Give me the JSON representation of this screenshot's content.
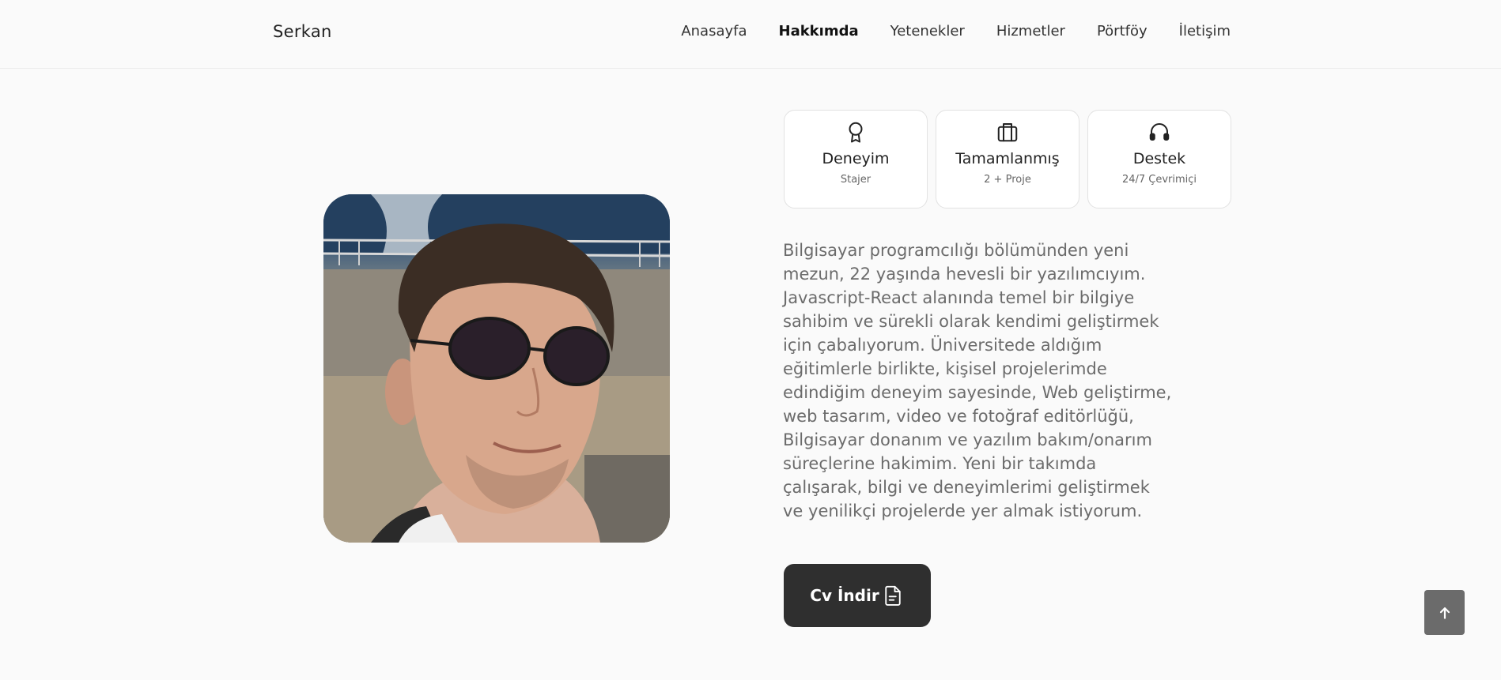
{
  "header": {
    "logo": "Serkan",
    "nav": [
      {
        "label": "Anasayfa",
        "active": false
      },
      {
        "label": "Hakkımda",
        "active": true
      },
      {
        "label": "Yetenekler",
        "active": false
      },
      {
        "label": "Hizmetler",
        "active": false
      },
      {
        "label": "Pörtföy",
        "active": false
      },
      {
        "label": "İletişim",
        "active": false
      }
    ]
  },
  "cards": [
    {
      "icon": "award-icon",
      "title": "Deneyim",
      "subtitle": "Stajer"
    },
    {
      "icon": "briefcase-icon",
      "title": "Tamamlanmış",
      "subtitle": "2 + Proje"
    },
    {
      "icon": "headphones-icon",
      "title": "Destek",
      "subtitle": "24/7 Çevrimiçi"
    }
  ],
  "about": {
    "text": "Bilgisayar programcılığı bölümünden yeni mezun, 22 yaşında hevesli bir yazılımcıyım. Javascript-React alanında temel bir bilgiye sahibim ve sürekli olarak kendimi geliştirmek için çabalıyorum. Üniversitede aldığım eğitimlerle birlikte, kişisel projelerimde edindiğim deneyim sayesinde, Web geliştirme, web tasarım, video ve fotoğraf editörlüğü, Bilgisayar donanım ve yazılım bakım/onarım süreçlerine hakimim. Yeni bir takımda çalışarak, bilgi ve deneyimlerimi geliştirmek ve yenilikçi projelerde yer almak istiyorum."
  },
  "cv_button": {
    "label": "Cv İndir",
    "icon": "file-icon"
  },
  "scroll_top": {
    "icon": "arrow-up-icon"
  },
  "colors": {
    "background": "#fafafa",
    "button_dark": "#2f2f2f",
    "scroll_button": "#6b6b6b",
    "body_text": "#6b6b6b"
  }
}
